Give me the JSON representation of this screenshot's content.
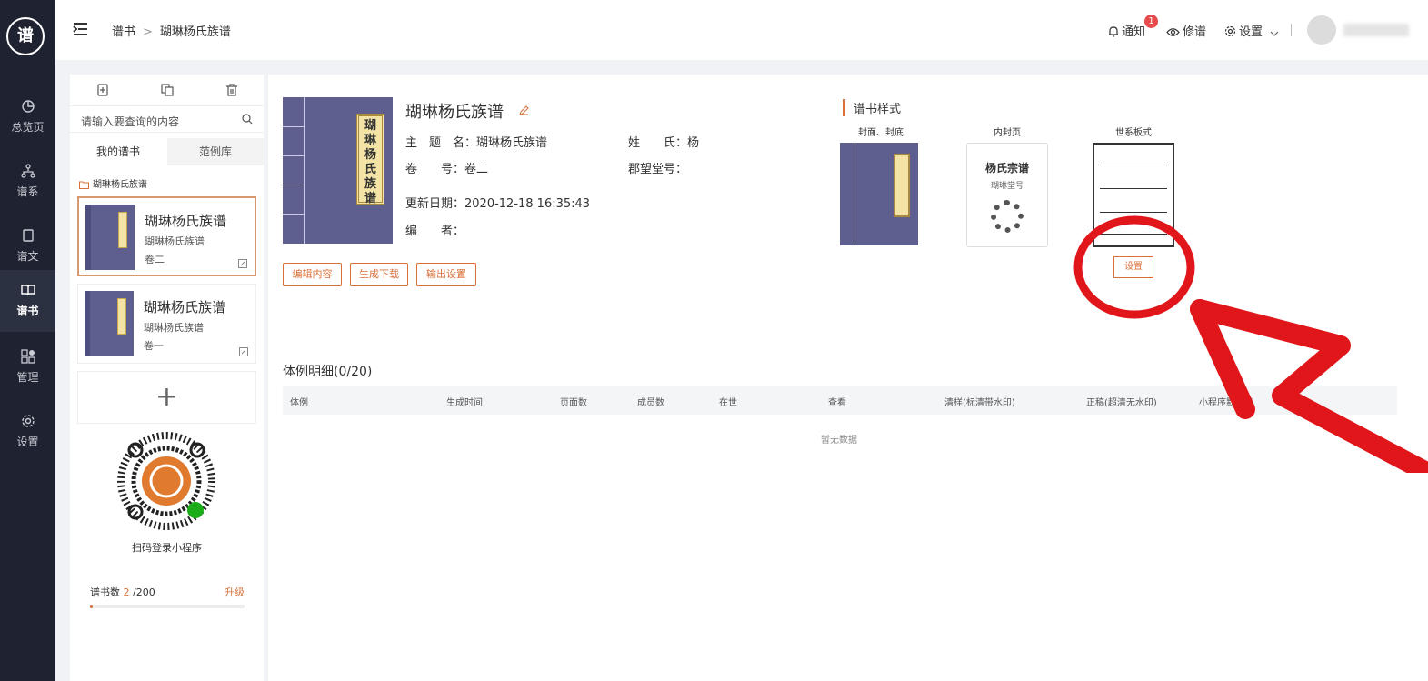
{
  "nav": {
    "logo_text": "谱",
    "items": [
      {
        "label": "总览页",
        "icon": "pie-chart-icon"
      },
      {
        "label": "谱系",
        "icon": "tree-icon"
      },
      {
        "label": "谱文",
        "icon": "document-icon"
      },
      {
        "label": "谱书",
        "icon": "book-icon",
        "active": true
      },
      {
        "label": "管理",
        "icon": "grid-icon"
      },
      {
        "label": "设置",
        "icon": "gear-icon"
      }
    ]
  },
  "header": {
    "breadcrumb": [
      "谱书",
      "瑚琳杨氏族谱"
    ],
    "notify_label": "通知",
    "notify_count": "1",
    "revise_label": "修谱",
    "settings_label": "设置"
  },
  "sidebar": {
    "search_placeholder": "请输入要查询的内容",
    "tabs": [
      "我的谱书",
      "范例库"
    ],
    "folder": "瑚琳杨氏族谱",
    "books": [
      {
        "title": "瑚琳杨氏族谱",
        "subtitle": "瑚琳杨氏族谱",
        "volume": "卷二",
        "selected": true
      },
      {
        "title": "瑚琳杨氏族谱",
        "subtitle": "瑚琳杨氏族谱",
        "volume": "卷一",
        "selected": false
      }
    ],
    "add_symbol": "+",
    "qr_label": "扫码登录小程序",
    "quota_label": "谱书数",
    "quota_used": "2",
    "quota_total": "/200",
    "quota_fraction": 0.01,
    "upgrade_label": "升级"
  },
  "book": {
    "cover_text": "瑚琳杨氏族谱",
    "name": "瑚琳杨氏族谱",
    "fields": {
      "theme": "主　题　名：瑚琳杨氏族谱",
      "surname": "姓　　氏：杨",
      "volume": "卷　　号：卷二",
      "hall": "郡望堂号：",
      "updated": "更新日期：2020-12-18 16:35:43",
      "editor": "编　　者："
    },
    "buttons": [
      "编辑内容",
      "生成下载",
      "输出设置"
    ]
  },
  "style": {
    "title": "谱书样式",
    "captions": [
      "封面、封底",
      "内封页",
      "世系板式"
    ],
    "inner_title": "杨氏宗谱",
    "inner_sub": "瑚琳堂号",
    "set_button": "设置"
  },
  "table": {
    "title": "体例明细(0/20)",
    "columns": [
      "体例",
      "生成时间",
      "页面数",
      "成员数",
      "在世",
      "查看",
      "清样(标清带水印)",
      "正稿(超清无水印)",
      "小程序默认显"
    ],
    "empty_text": "暂无数据"
  },
  "colors": {
    "accent": "#d9703a",
    "nav_bg": "#1f2331",
    "cover": "#5e5f8f",
    "annotation": "#e0161a"
  }
}
